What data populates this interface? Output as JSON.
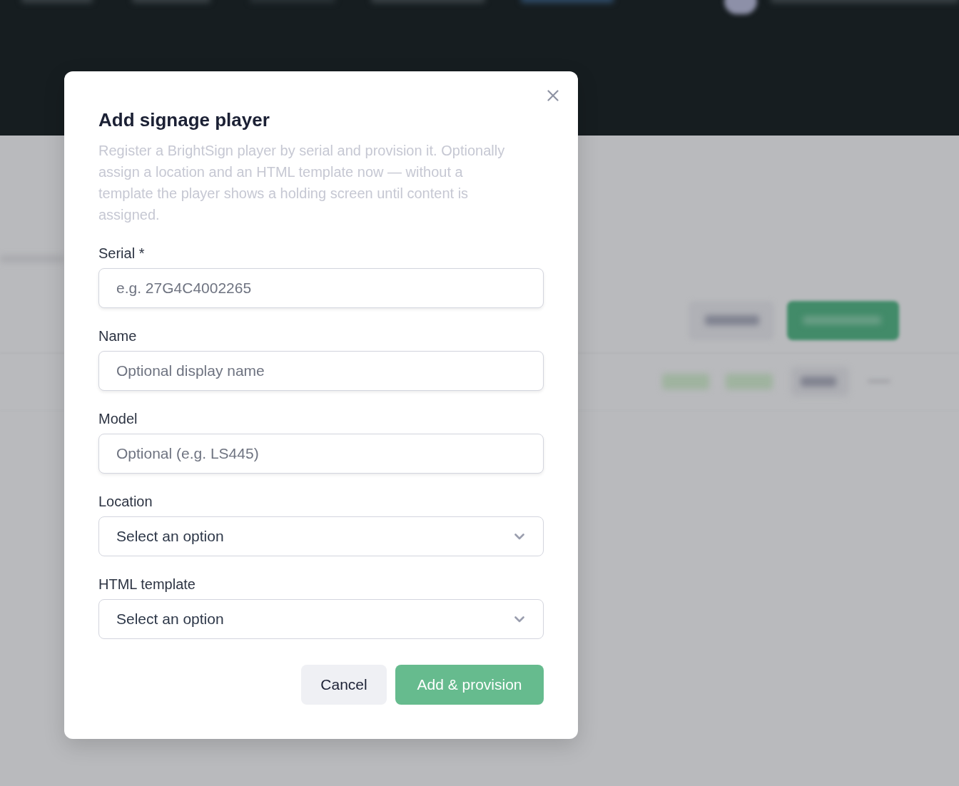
{
  "dialog": {
    "title": "Add signage player",
    "description": "Register a BrightSign player by serial and provision it. Optionally assign a location and an HTML template now — without a template the player shows a holding screen until content is assigned.",
    "fields": [
      {
        "kind": "text",
        "label": "Serial *",
        "placeholder": "e.g. 27G4C4002265"
      },
      {
        "kind": "text",
        "label": "Name",
        "placeholder": "Optional display name"
      },
      {
        "kind": "text",
        "label": "Model",
        "placeholder": "Optional (e.g. LS445)"
      },
      {
        "kind": "select",
        "label": "Location",
        "value": "Select an option"
      },
      {
        "kind": "select",
        "label": "HTML template",
        "value": "Select an option"
      }
    ],
    "buttons": [
      {
        "kind": "secondary",
        "label": "Cancel"
      },
      {
        "kind": "primary",
        "label": "Add & provision"
      }
    ]
  }
}
